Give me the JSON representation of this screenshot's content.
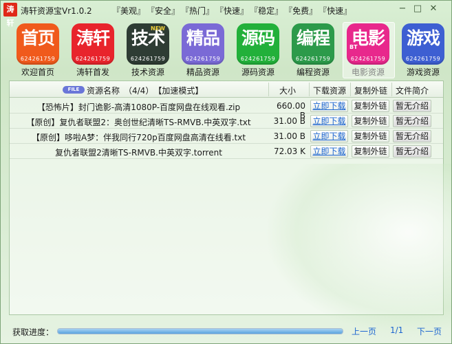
{
  "window": {
    "title": "涛轩资源宝Vr1.0.2",
    "icon_text": "涛轩",
    "slogans": [
      "『美观』",
      "『安全』",
      "『热门』",
      "『快速』",
      "『稳定』",
      "『免费』",
      "『快速』"
    ],
    "controls": {
      "minimize": "−",
      "maximize": "□",
      "close": "✕"
    }
  },
  "tiles": [
    {
      "glyph": "首页",
      "number": "624261759",
      "label": "欢迎首页",
      "color": "#f05a1c",
      "badge": ""
    },
    {
      "glyph": "涛轩",
      "number": "624261759",
      "label": "涛轩首发",
      "color": "#e8242c",
      "badge": ""
    },
    {
      "glyph": "技术",
      "number": "624261759",
      "label": "技术资源",
      "color": "#2e3c34",
      "badge": "NEW"
    },
    {
      "glyph": "精品",
      "number": "624261759",
      "label": "精品资源",
      "color": "#7a6ad6",
      "badge": ""
    },
    {
      "glyph": "源码",
      "number": "624261759",
      "label": "源码资源",
      "color": "#22b03a",
      "badge": ""
    },
    {
      "glyph": "编程",
      "number": "624261759",
      "label": "编程资源",
      "color": "#2c9a4a",
      "badge": ""
    },
    {
      "glyph": "电影",
      "number": "624261759",
      "label": "电影资源",
      "color": "#e8288c",
      "badge": "BT"
    },
    {
      "glyph": "游戏",
      "number": "624261759",
      "label": "游戏资源",
      "color": "#3d5fd2",
      "badge": ""
    }
  ],
  "table": {
    "file_badge": "FILE",
    "header_name": "资源名称　（4/4）　【加速模式】",
    "headers": [
      "大小",
      "下载资源",
      "复制外链",
      "文件简介"
    ],
    "rows": [
      {
        "name": "【恐怖片】封门诡影-高清1080P-百度网盘在线观看.zip",
        "size": "660.00 B",
        "download": "立即下载",
        "copy": "复制外链",
        "intro": "暂无介绍"
      },
      {
        "name": "【原创】复仇者联盟2：奥创世纪清晰TS-RMVB.中英双字.txt",
        "size": "31.00 B",
        "download": "立即下载",
        "copy": "复制外链",
        "intro": "暂无介绍"
      },
      {
        "name": "【原创】哆啦A梦：伴我同行720p百度网盘高清在线看.txt",
        "size": "31.00 B",
        "download": "立即下载",
        "copy": "复制外链",
        "intro": "暂无介绍"
      },
      {
        "name": "复仇者联盟2清晰TS-RMVB.中英双字.torrent",
        "size": "72.03 K",
        "download": "立即下载",
        "copy": "复制外链",
        "intro": "暂无介绍"
      }
    ]
  },
  "footer": {
    "progress_label": "获取进度：",
    "progress_value": 1.0,
    "prev": "上一页",
    "page_info": "1/1",
    "next": "下一页"
  }
}
